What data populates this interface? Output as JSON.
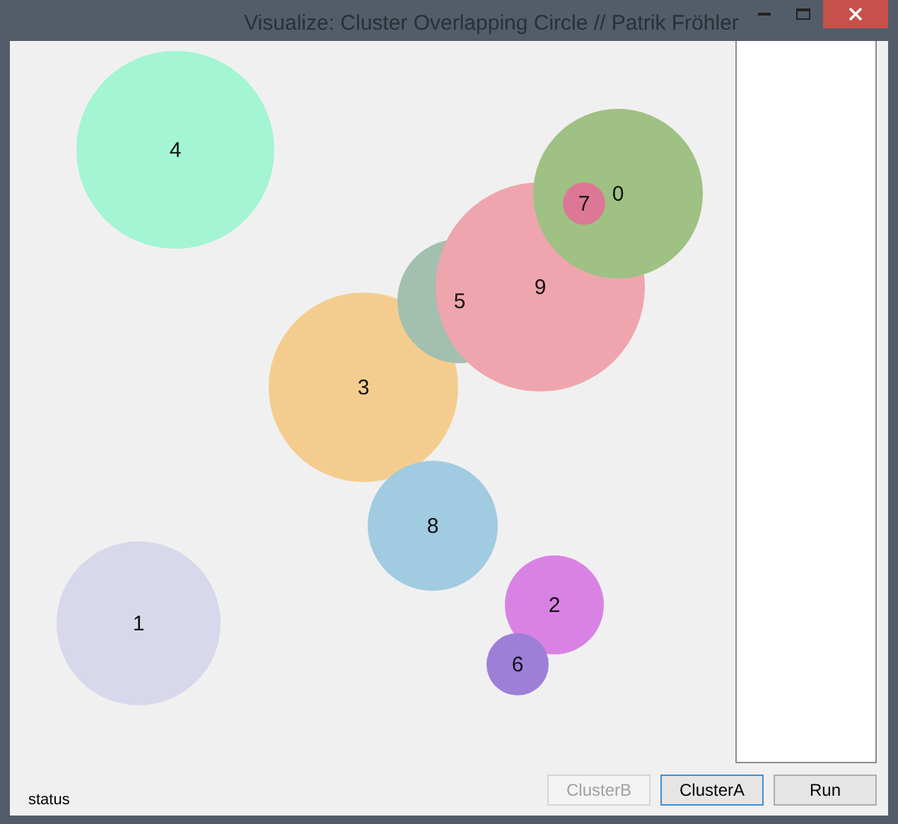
{
  "window": {
    "title": "Visualize: Cluster Overlapping Circle // Patrik Fröhler"
  },
  "circles": [
    {
      "label": "4",
      "color": "#a3f5d3"
    },
    {
      "label": "3",
      "color": "#f4cd8e"
    },
    {
      "label": "5",
      "color": "#a3bfb0"
    },
    {
      "label": "9",
      "color": "#efa5ad"
    },
    {
      "label": "0",
      "color": "#9fc183"
    },
    {
      "label": "7",
      "color": "#dc7896"
    },
    {
      "label": "8",
      "color": "#a0cbe1"
    },
    {
      "label": "2",
      "color": "#d883e3"
    },
    {
      "label": "1",
      "color": "#d8d8ec"
    },
    {
      "label": "6",
      "color": "#9d7fd8"
    }
  ],
  "status": "status",
  "buttons": [
    {
      "label": "ClusterB",
      "disabled": true,
      "focused": false
    },
    {
      "label": "ClusterA",
      "disabled": false,
      "focused": true
    },
    {
      "label": "Run",
      "disabled": false,
      "focused": false
    }
  ]
}
